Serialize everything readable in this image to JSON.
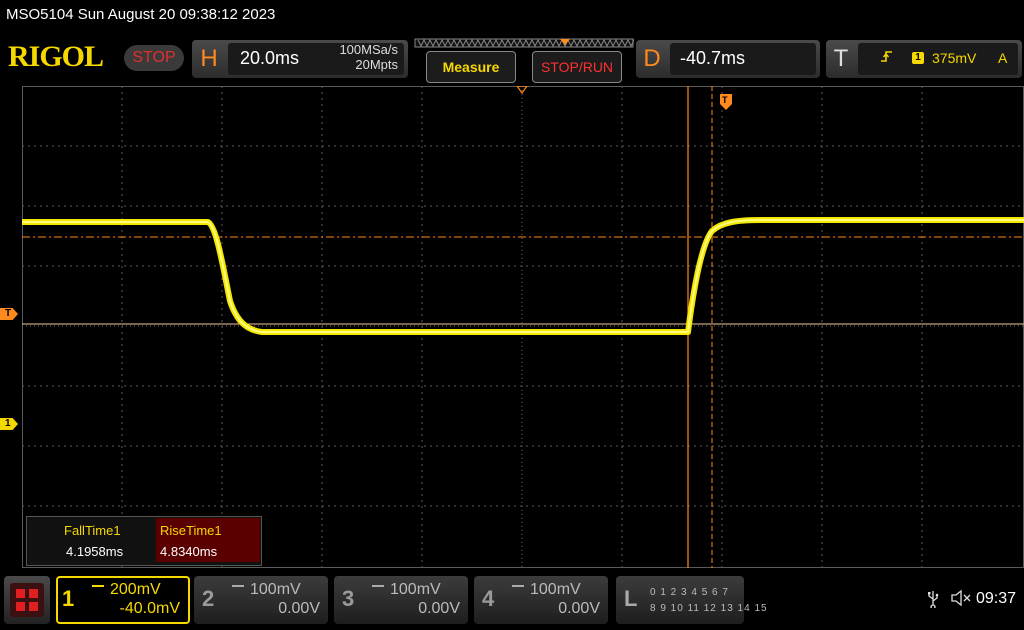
{
  "device": {
    "title": "MSO5104  Sun August 20 09:38:12 2023",
    "logo": "RIGOL",
    "status": "STOP"
  },
  "horizontal": {
    "letter": "H",
    "scale": "20.0ms",
    "sample_rate": "100MSa/s",
    "memory_depth": "20Mpts"
  },
  "buttons": {
    "measure": "Measure",
    "stop_run": "STOP/RUN"
  },
  "delay": {
    "letter": "D",
    "value": "-40.7ms"
  },
  "trigger": {
    "letter": "T",
    "edge_icon": "rising-edge-icon",
    "channel": "1",
    "level": "375mV",
    "mode": "A",
    "marker_label": "T"
  },
  "measurements": [
    {
      "name": "FallTime1",
      "value": "4.1958ms"
    },
    {
      "name": "RiseTime1",
      "value": "4.8340ms"
    }
  ],
  "channels": [
    {
      "num": "1",
      "scale": "200mV",
      "offset": "-40.0mV",
      "active": true,
      "color": "#f5d800"
    },
    {
      "num": "2",
      "scale": "100mV",
      "offset": "0.00V",
      "active": false,
      "color": "#9a9a9a"
    },
    {
      "num": "3",
      "scale": "100mV",
      "offset": "0.00V",
      "active": false,
      "color": "#9a9a9a"
    },
    {
      "num": "4",
      "scale": "100mV",
      "offset": "0.00V",
      "active": false,
      "color": "#9a9a9a"
    }
  ],
  "logic": {
    "letter": "L",
    "row1": "0 1 2 3   4 5 6 7",
    "row2": "8  9 10 11  12 13 14 15"
  },
  "ch1_marker_label": "1",
  "status_bar": {
    "time": "09:37",
    "usb_icon": "usb-icon",
    "sound_icon": "speaker-mute-icon"
  },
  "colors": {
    "channel1": "#f5d800",
    "trigger": "#ff8a1e",
    "stop": "#e03030",
    "grid": "#5a5a5a"
  }
}
